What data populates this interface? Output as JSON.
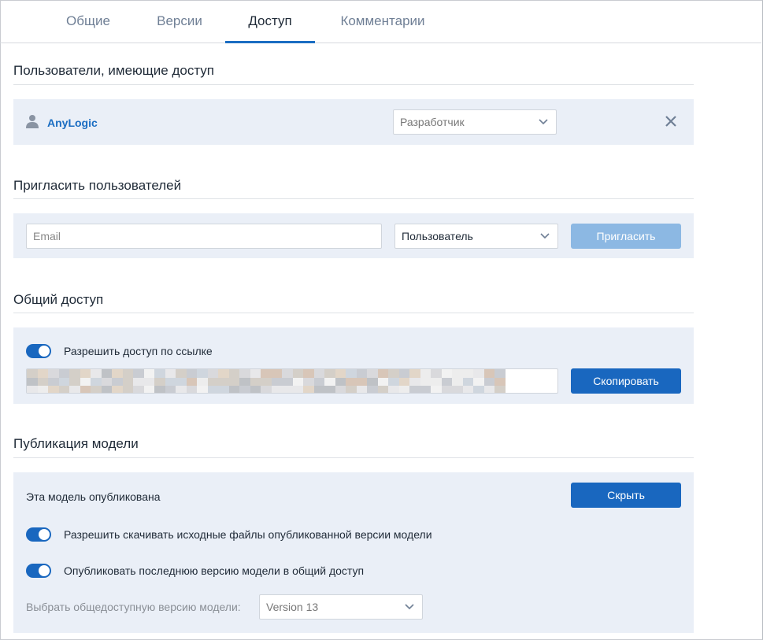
{
  "tabs": [
    {
      "label": "Общие"
    },
    {
      "label": "Версии"
    },
    {
      "label": "Доступ"
    },
    {
      "label": "Комментарии"
    }
  ],
  "active_tab": "Доступ",
  "users_section": {
    "title": "Пользователи, имеющие доступ",
    "users": [
      {
        "name": "AnyLogic",
        "role": "Разработчик"
      }
    ]
  },
  "invite_section": {
    "title": "Пригласить пользователей",
    "email_placeholder": "Email",
    "role_value": "Пользователь",
    "invite_button": "Пригласить"
  },
  "shared_section": {
    "title": "Общий доступ",
    "link_toggle_label": "Разрешить доступ по ссылке",
    "link_toggle_on": true,
    "copy_button": "Скопировать"
  },
  "publish_section": {
    "title": "Публикация модели",
    "status_text": "Эта модель опубликована",
    "hide_button": "Скрыть",
    "download_toggle_label": "Разрешить скачивать исходные файлы опубликованной версии модели",
    "download_toggle_on": true,
    "latest_toggle_label": "Опубликовать последнюю версию модели в общий доступ",
    "latest_toggle_on": true,
    "version_select_label": "Выбрать общедоступную версию модели:",
    "version_value": "Version 13"
  },
  "colors": {
    "accent": "#1967bf",
    "accent_disabled": "#8cb8e3",
    "panel_bg": "#eaeff7",
    "link_text": "#1a6dc2"
  }
}
